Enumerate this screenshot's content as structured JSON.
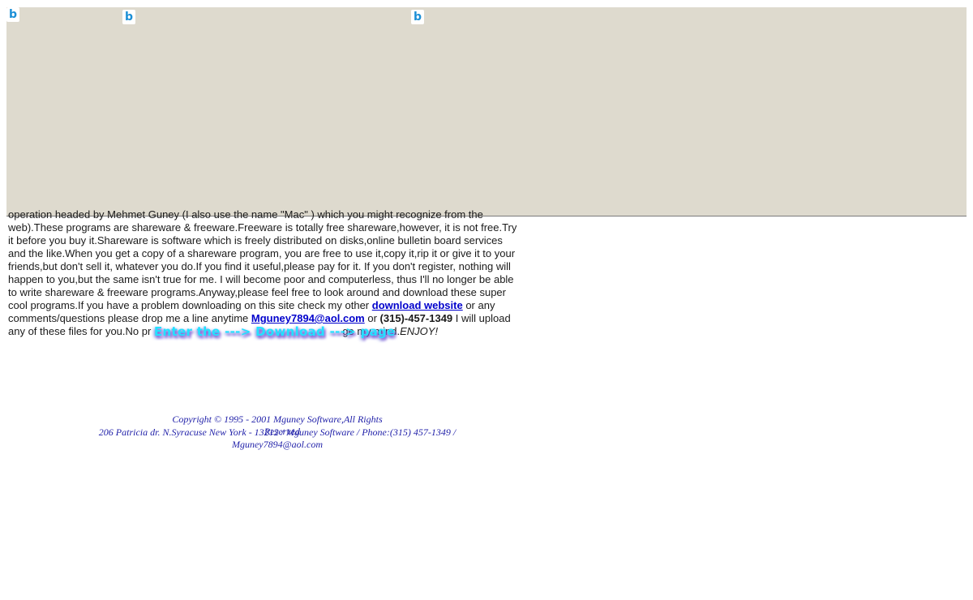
{
  "icons": [
    "b-logo-icon",
    "b-logo-icon",
    "b-logo-icon"
  ],
  "body": {
    "line_clipped": "operation headed by Mehmet Guney (I also use the name \"Mac\" ) which you might recognize from the",
    "text_1": "web).These programs are shareware & freeware.Freeware is totally free shareware,however, it is not free.Try it before you buy it.Shareware is software which is freely distributed on disks,online bulletin board services and the like.When you get a copy of a shareware program, you are free to use it,copy it,rip it or give it to your friends,but don't sell it, whatever you do.If you find it useful,please pay for it. If you don't register, nothing will happen to you,but the same isn't true for me. I will become poor and computerless, thus I'll no longer be able to write shareware & freeware programs.Anyway,please feel free to look around and download these super cool programs.If you have a problem downloading on this site check my other ",
    "download_link": "download website",
    "text_2": " or any comments/questions please drop me a line anytime ",
    "email_link": "Mguney7894@aol.com",
    "text_3": " or ",
    "phone": "(315)-457-1349",
    "text_4": " I will upload any of these files for you.No pr",
    "text_5": "ge my mind.",
    "enjoy": "ENJOY!"
  },
  "enter_banner": "Enter the ---> Download ---> page",
  "footer": {
    "copyright": "Copyright © 1995 - 2001 Mguney Software,All Rights",
    "overlap_word": "Reserved",
    "address": "206 Patricia dr. N.Syracuse New York - 13212 / Mguney Software / Phone:(315) 457-1349 /",
    "email": "Mguney7894@aol.com"
  }
}
